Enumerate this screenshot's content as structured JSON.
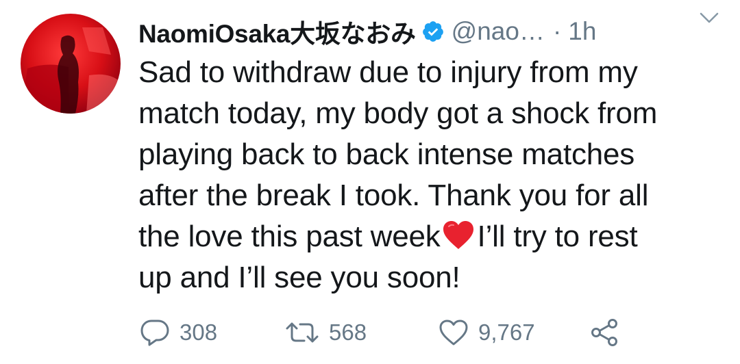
{
  "tweet": {
    "display_name": "NaomiOsaka大坂なおみ",
    "handle": "@nao…",
    "separator": "·",
    "time": "1h",
    "text_lines": [
      "Sad to withdraw due to injury from my",
      "match today, my body got a shock from",
      "playing back to back intense matches",
      "after the break I took. Thank you for all"
    ],
    "line5_before": "the love this past week",
    "line5_after": "I’ll try to rest",
    "line6": "up and I’ll see you soon!",
    "emoji": "red-heart"
  },
  "actions": {
    "reply_count": "308",
    "retweet_count": "568",
    "like_count": "9,767"
  },
  "colors": {
    "text": "#14171a",
    "secondary": "#657786",
    "verified": "#1da1f2",
    "heart": "#e0245e"
  },
  "icons": [
    "verified-badge-icon",
    "chevron-down-icon",
    "reply-icon",
    "retweet-icon",
    "like-icon",
    "share-icon"
  ]
}
